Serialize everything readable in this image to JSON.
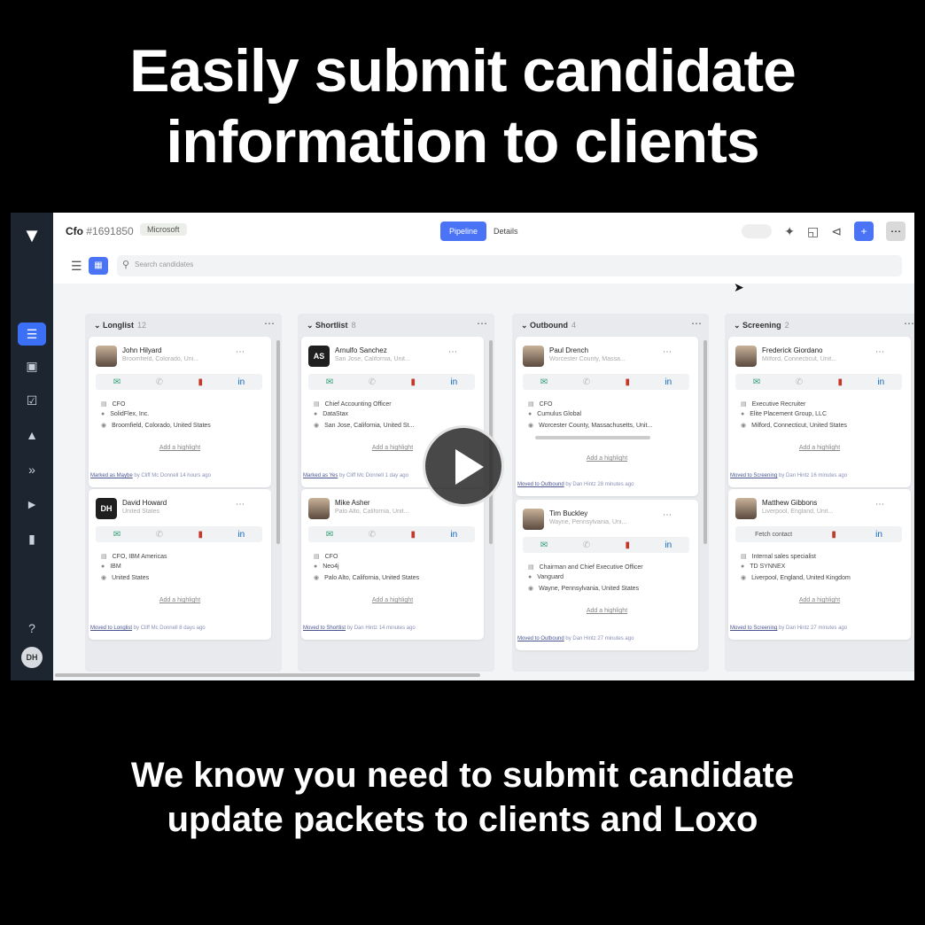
{
  "headline": {
    "line1": "Easily submit candidate",
    "line2": "information to clients"
  },
  "caption": {
    "line1": "We know you need to submit candidate",
    "line2": "update packets to clients and Loxo"
  },
  "app": {
    "title": "Cfo",
    "job_id": "#1691850",
    "company": "Microsoft",
    "tabs": [
      "Pipeline",
      "Details"
    ],
    "search_placeholder": "Search candidates",
    "sidebar_avatar": "DH",
    "columns": [
      {
        "name": "Longlist",
        "count": "12",
        "cards": [
          {
            "name": "John Hilyard",
            "location": "Broomfield, Colorado, Uni...",
            "avatar": "",
            "fields": [
              "CFO",
              "SolidFlex, Inc.",
              "Broomfield, Colorado, United States"
            ],
            "highlight": "Add a highlight",
            "activity_link": "Marked as Maybe",
            "activity_rest": " by Cliff Mc Donnell 14 hours ago"
          },
          {
            "name": "David Howard",
            "location": "United States",
            "avatar": "DH",
            "fields": [
              "CFO, IBM Americas",
              "IBM",
              "United States"
            ],
            "highlight": "Add a highlight",
            "activity_link": "Moved to Longlist",
            "activity_rest": " by Cliff Mc Donnell 8 days ago"
          }
        ]
      },
      {
        "name": "Shortlist",
        "count": "8",
        "cards": [
          {
            "name": "Arnulfo Sanchez",
            "location": "San Jose, California, Unit...",
            "avatar": "AS",
            "fields": [
              "Chief Accounting Officer",
              "DataStax",
              "San Jose, California, United St..."
            ],
            "highlight": "Add a highlight",
            "activity_link": "Marked as Yes",
            "activity_rest": " by Cliff Mc Donnell 1 day ago"
          },
          {
            "name": "Mike Asher",
            "location": "Palo Alto, California, Unit...",
            "avatar": "",
            "fields": [
              "CFO",
              "Neo4j",
              "Palo Alto, California, United States"
            ],
            "highlight": "Add a highlight",
            "activity_link": "Moved to Shortlist",
            "activity_rest": " by Dan Hintz 14 minutes ago"
          }
        ]
      },
      {
        "name": "Outbound",
        "count": "4",
        "cards": [
          {
            "name": "Paul Drench",
            "location": "Worcester County, Massa...",
            "avatar": "",
            "fields": [
              "CFO",
              "Cumulus Global",
              "Worcester County, Massachusetts, Unit..."
            ],
            "highlight": "Add a highlight",
            "activity_link": "Moved to Outbound",
            "activity_rest": " by Dan Hintz 28 minutes ago"
          },
          {
            "name": "Tim Buckley",
            "location": "Wayne, Pennsylvania, Uni...",
            "avatar": "",
            "fields": [
              "Chairman and Chief Executive Officer",
              "Vanguard",
              "Wayne, Pennsylvania, United States"
            ],
            "highlight": "Add a highlight",
            "activity_link": "Moved to Outbound",
            "activity_rest": " by Dan Hintz 27 minutes ago"
          }
        ]
      },
      {
        "name": "Screening",
        "count": "2",
        "cards": [
          {
            "name": "Frederick Giordano",
            "location": "Milford, Connecticut, Unit...",
            "avatar": "",
            "fields": [
              "Executive Recruiter",
              "Elite Placement Group, LLC",
              "Milford, Connecticut, United States"
            ],
            "highlight": "Add a highlight",
            "activity_link": "Moved to Screening",
            "activity_rest": " by Dan Hintz 16 minutes ago"
          },
          {
            "name": "Matthew Gibbons",
            "location": "Liverpool, England, Unit...",
            "avatar": "",
            "fields": [
              "Internal sales specialist",
              "TD SYNNEX",
              "Liverpool, England, United Kingdom"
            ],
            "highlight": "Add a highlight",
            "activity_link": "Moved to Screening",
            "activity_rest": " by Dan Hintz 27 minutes ago",
            "enrich": "Fetch contact"
          }
        ]
      }
    ]
  }
}
